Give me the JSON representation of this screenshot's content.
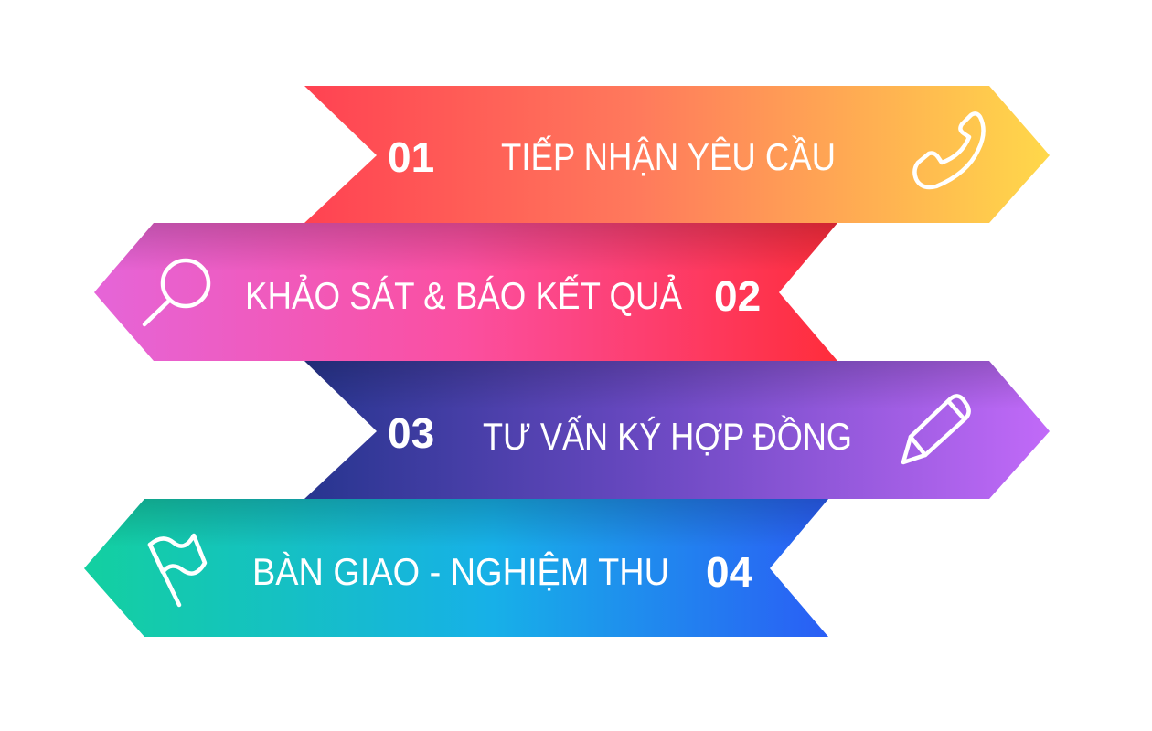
{
  "steps": [
    {
      "number": "01",
      "label": "TIẾP NHẬN YÊU CẦU",
      "icon": "phone-icon",
      "colors": [
        "#ff4252",
        "#ff7a5c",
        "#ffd84a"
      ]
    },
    {
      "number": "02",
      "label": "KHẢO SÁT & BÁO KẾT QUẢ",
      "icon": "magnifier-icon",
      "colors": [
        "#e565d8",
        "#fb4fa0",
        "#ff2d3b"
      ]
    },
    {
      "number": "03",
      "label": "TƯ VẤN KÝ HỢP ĐỒNG",
      "icon": "pencil-icon",
      "colors": [
        "#27358f",
        "#6848c0",
        "#c16af8"
      ]
    },
    {
      "number": "04",
      "label": "BÀN GIAO - NGHIỆM THU",
      "icon": "flag-icon",
      "colors": [
        "#13d0a0",
        "#17b0e8",
        "#2a5ef5"
      ]
    }
  ]
}
